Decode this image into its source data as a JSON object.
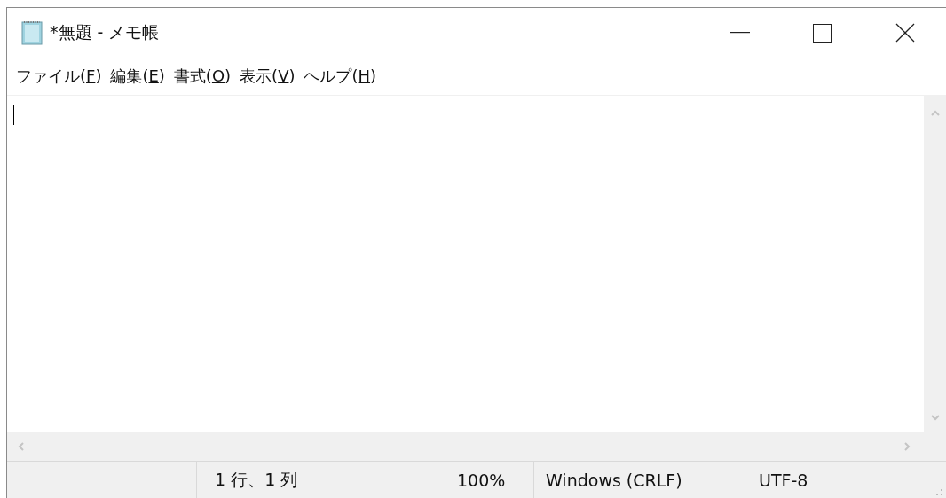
{
  "window": {
    "title": "*無題 - メモ帳"
  },
  "menu": [
    {
      "before": "ファイル(",
      "access_key": "F",
      "after": ")"
    },
    {
      "before": "編集(",
      "access_key": "E",
      "after": ")"
    },
    {
      "before": "書式(",
      "access_key": "O",
      "after": ")"
    },
    {
      "before": "表示(",
      "access_key": "V",
      "after": ")"
    },
    {
      "before": "ヘルプ(",
      "access_key": "H",
      "after": ")"
    }
  ],
  "status_bar": [
    "1 行、1 列",
    "100%",
    "Windows (CRLF)",
    "UTF-8"
  ]
}
